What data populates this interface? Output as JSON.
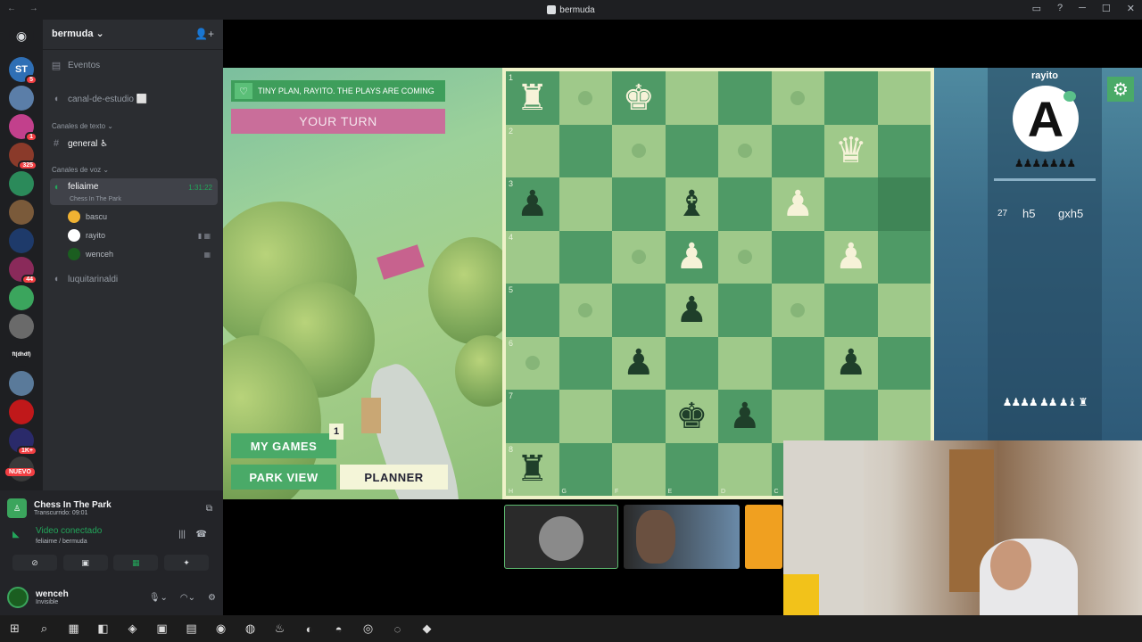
{
  "window": {
    "title": "bermuda"
  },
  "server": {
    "name": "bermuda"
  },
  "servers": [
    {
      "label": "ST",
      "color": "#2f6fb5",
      "badge": "5"
    },
    {
      "label": "",
      "color": "#5b7ea8",
      "badge": ""
    },
    {
      "label": "",
      "color": "#c2408c",
      "badge": "1"
    },
    {
      "label": "",
      "color": "#8a3a2a",
      "badge": "325"
    },
    {
      "label": "",
      "color": "#2b8a5a",
      "badge": ""
    },
    {
      "label": "",
      "color": "#7a5a3a",
      "badge": ""
    },
    {
      "label": "",
      "color": "#1e3a6a",
      "badge": ""
    },
    {
      "label": "",
      "color": "#8a2a5a",
      "badge": "44"
    },
    {
      "label": "",
      "color": "#3ba55d",
      "badge": ""
    },
    {
      "label": "",
      "color": "#6a6a6a",
      "badge": ""
    },
    {
      "label": "ft(dhdf)",
      "color": "#1e1f22",
      "badge": ""
    },
    {
      "label": "",
      "color": "#5a7a9a",
      "badge": ""
    },
    {
      "label": "",
      "color": "#c0181a",
      "badge": ""
    },
    {
      "label": "",
      "color": "#2a2a6a",
      "badge": "1K+"
    },
    {
      "label": "",
      "color": "#3a3a3a",
      "badge": ""
    }
  ],
  "new_label": "NUEVO",
  "channels": {
    "events": "Eventos",
    "study": "canal-de-estudio ⬜",
    "text_category": "Canales de texto",
    "general": "general ♿",
    "voice_category": "Canales de voz",
    "active_voice": "feliaime",
    "active_voice_time": "1:31:22",
    "active_voice_activity": "Chess In The Park",
    "members": [
      "bascu",
      "rayito",
      "wenceh"
    ],
    "other_voice": "luquitarinaldi"
  },
  "activity": {
    "title": "Chess In The Park",
    "subtitle": "Transcurrido: 09:01"
  },
  "voice": {
    "status": "Video conectado",
    "location": "feliaime / bermuda"
  },
  "user": {
    "name": "wenceh",
    "status": "Invisible"
  },
  "game": {
    "banner": "TINY PLAN, RAYITO. THE PLAYS ARE COMING",
    "turn": "YOUR TURN",
    "my_games": "MY GAMES",
    "my_games_badge": "1",
    "park_view": "PARK VIEW",
    "planner": "PLANNER"
  },
  "board": {
    "ranks": [
      "1",
      "2",
      "3",
      "4",
      "5",
      "6",
      "7",
      "8"
    ],
    "files": [
      "H",
      "G",
      "F",
      "E",
      "D",
      "C",
      "B",
      "A"
    ],
    "squares": [
      [
        "wR",
        "dot",
        "wK",
        "",
        "",
        "dot",
        "",
        ""
      ],
      [
        "",
        "",
        "dot",
        "",
        "dot",
        "",
        "wQ",
        ""
      ],
      [
        "bP",
        "",
        "",
        "bB",
        "",
        "wP",
        "",
        "HL"
      ],
      [
        "",
        "",
        "dot",
        "wP",
        "dot",
        "",
        "wP",
        ""
      ],
      [
        "",
        "dot",
        "",
        "bP",
        "",
        "dot",
        "",
        ""
      ],
      [
        "dot",
        "",
        "bP",
        "",
        "",
        "",
        "bP",
        ""
      ],
      [
        "",
        "",
        "",
        "bK",
        "bP",
        "",
        "",
        ""
      ],
      [
        "bR",
        "",
        "",
        "",
        "",
        "",
        "",
        ""
      ]
    ]
  },
  "opponent": {
    "name": "rayito",
    "avatar_letter": "A",
    "captured_top": "♟♟♟♟♟♟♟",
    "move_number": "27",
    "move_white": "h5",
    "move_black": "gxh5",
    "captured_bottom": "♟♟♟♟ ♟♟ ♟♝ ♜"
  },
  "taskbar": [
    "⊞",
    "⌕",
    "▦",
    "◧",
    "◈",
    "▣",
    "▤",
    "◉",
    "◍",
    "♨",
    "◐",
    "◓",
    "◎",
    "◌",
    "◆"
  ]
}
